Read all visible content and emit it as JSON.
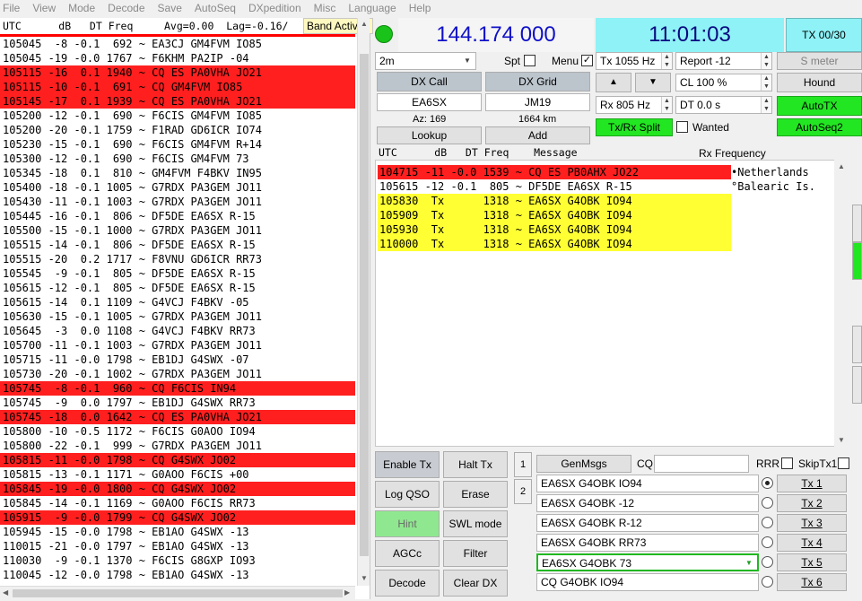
{
  "menu": [
    "File",
    "View",
    "Mode",
    "Decode",
    "Save",
    "AutoSeq",
    "DXpedition",
    "Misc",
    "Language",
    "Help"
  ],
  "band": {
    "header": "UTC      dB   DT Freq     Avg=0.00  Lag=-0.16/",
    "title": "Band Activity",
    "rows": [
      {
        "text": "105045  -8 -0.1  692 ~ EA3CJ GM4FVM IO85",
        "cq": false
      },
      {
        "text": "105045 -19 -0.0 1767 ~ F6KHM PA2IP -04",
        "cq": false
      },
      {
        "text": "105115 -16  0.1 1940 ~ CQ ES PA0VHA JO21",
        "cq": true
      },
      {
        "text": "105115 -10 -0.1  691 ~ CQ GM4FVM IO85",
        "cq": true
      },
      {
        "text": "105145 -17  0.1 1939 ~ CQ ES PA0VHA JO21",
        "cq": true
      },
      {
        "text": "105200 -12 -0.1  690 ~ F6CIS GM4FVM IO85",
        "cq": false
      },
      {
        "text": "105200 -20 -0.1 1759 ~ F1RAD GD6ICR IO74",
        "cq": false
      },
      {
        "text": "105230 -15 -0.1  690 ~ F6CIS GM4FVM R+14",
        "cq": false
      },
      {
        "text": "105300 -12 -0.1  690 ~ F6CIS GM4FVM 73",
        "cq": false
      },
      {
        "text": "105345 -18  0.1  810 ~ GM4FVM F4BKV IN95",
        "cq": false
      },
      {
        "text": "105400 -18 -0.1 1005 ~ G7RDX PA3GEM JO11",
        "cq": false
      },
      {
        "text": "105430 -11 -0.1 1003 ~ G7RDX PA3GEM JO11",
        "cq": false
      },
      {
        "text": "105445 -16 -0.1  806 ~ DF5DE EA6SX R-15",
        "cq": false
      },
      {
        "text": "105500 -15 -0.1 1000 ~ G7RDX PA3GEM JO11",
        "cq": false
      },
      {
        "text": "105515 -14 -0.1  806 ~ DF5DE EA6SX R-15",
        "cq": false
      },
      {
        "text": "105515 -20  0.2 1717 ~ F8VNU GD6ICR RR73",
        "cq": false
      },
      {
        "text": "105545  -9 -0.1  805 ~ DF5DE EA6SX R-15",
        "cq": false
      },
      {
        "text": "105615 -12 -0.1  805 ~ DF5DE EA6SX R-15",
        "cq": false
      },
      {
        "text": "105615 -14  0.1 1109 ~ G4VCJ F4BKV -05",
        "cq": false
      },
      {
        "text": "105630 -15 -0.1 1005 ~ G7RDX PA3GEM JO11",
        "cq": false
      },
      {
        "text": "105645  -3  0.0 1108 ~ G4VCJ F4BKV RR73",
        "cq": false
      },
      {
        "text": "105700 -11 -0.1 1003 ~ G7RDX PA3GEM JO11",
        "cq": false
      },
      {
        "text": "105715 -11 -0.0 1798 ~ EB1DJ G4SWX -07",
        "cq": false
      },
      {
        "text": "105730 -20 -0.1 1002 ~ G7RDX PA3GEM JO11",
        "cq": false
      },
      {
        "text": "105745  -8 -0.1  960 ~ CQ F6CIS IN94",
        "cq": true
      },
      {
        "text": "105745  -9  0.0 1797 ~ EB1DJ G4SWX RR73",
        "cq": false
      },
      {
        "text": "105745 -18  0.0 1642 ~ CQ ES PA0VHA JO21",
        "cq": true
      },
      {
        "text": "105800 -10 -0.5 1172 ~ F6CIS G0AOO IO94",
        "cq": false
      },
      {
        "text": "105800 -22 -0.1  999 ~ G7RDX PA3GEM JO11",
        "cq": false
      },
      {
        "text": "105815 -11 -0.0 1798 ~ CQ G4SWX JO02",
        "cq": true
      },
      {
        "text": "105815 -13 -0.1 1171 ~ G0AOO F6CIS +00",
        "cq": false
      },
      {
        "text": "105845 -19 -0.0 1800 ~ CQ G4SWX JO02",
        "cq": true
      },
      {
        "text": "105845 -14 -0.1 1169 ~ G0AOO F6CIS RR73",
        "cq": false
      },
      {
        "text": "105915  -9 -0.0 1799 ~ CQ G4SWX JO02",
        "cq": true
      },
      {
        "text": "105945 -15 -0.0 1798 ~ EB1AO G4SWX -13",
        "cq": false
      },
      {
        "text": "110015 -21 -0.0 1797 ~ EB1AO G4SWX -13",
        "cq": false
      },
      {
        "text": "110030  -9 -0.1 1370 ~ F6CIS G8GXP IO93",
        "cq": false
      },
      {
        "text": "110045 -12 -0.0 1798 ~ EB1AO G4SWX -13",
        "cq": false
      }
    ]
  },
  "top": {
    "frequency": "144.174 000",
    "clock": "11:01:03",
    "tx_counter": "TX 00/30",
    "band": "2m",
    "spt_label": "Spt",
    "menu_label": "Menu",
    "menu_check": "✓",
    "tx_freq": "Tx  1055 Hz",
    "rx_freq": "Rx  805 Hz",
    "report": "Report -12",
    "cl": "CL  100 %",
    "dt": "DT 0.0 s",
    "s_meter": "S meter",
    "hound": "Hound",
    "autotx": "AutoTX",
    "autoseq2": "AutoSeq2",
    "txrx_split": "Tx/Rx Split",
    "wanted": "Wanted",
    "up_arrow": "▲",
    "down_arrow": "▼",
    "dx_call_btn": "DX Call",
    "dx_grid_btn": "DX Grid",
    "dx_call": "EA6SX",
    "dx_grid": "JM19",
    "az": "Az: 169",
    "distance": "1664 km",
    "lookup": "Lookup",
    "add": "Add"
  },
  "rx": {
    "header": "UTC      dB   DT Freq    Message",
    "title": "Rx Frequency",
    "rows": [
      {
        "text": "104715 -11 -0.0 1539 ~ CQ ES PB0AHX JO22",
        "kind": "cq"
      },
      {
        "text": "105615 -12 -0.1  805 ~ DF5DE EA6SX R-15",
        "kind": "plain"
      },
      {
        "text": "105830  Tx      1318 ~ EA6SX G4OBK IO94",
        "kind": "tx"
      },
      {
        "text": "105909  Tx      1318 ~ EA6SX G4OBK IO94",
        "kind": "tx"
      },
      {
        "text": "105930  Tx      1318 ~ EA6SX G4OBK IO94",
        "kind": "tx"
      },
      {
        "text": "110000  Tx      1318 ~ EA6SX G4OBK IO94",
        "kind": "tx"
      }
    ],
    "countries": [
      "•Netherlands",
      "°Balearic Is."
    ]
  },
  "bottom": {
    "enable_tx": "Enable Tx",
    "halt_tx": "Halt Tx",
    "log_qso": "Log QSO",
    "erase": "Erase",
    "hint": "Hint",
    "swl_mode": "SWL mode",
    "agcc": "AGCc",
    "filter": "Filter",
    "decode": "Decode",
    "clear_dx": "Clear DX",
    "tab1": "1",
    "tab2": "2",
    "genmsgs": "GenMsgs",
    "cq_label": "CQ",
    "rrr": "RRR",
    "skiptx1": "SkipTx1",
    "messages": [
      {
        "text": "EA6SX G4OBK IO94",
        "btn": "Tx 1"
      },
      {
        "text": "EA6SX G4OBK -12",
        "btn": "Tx 2"
      },
      {
        "text": "EA6SX G4OBK R-12",
        "btn": "Tx 3"
      },
      {
        "text": "EA6SX G4OBK RR73",
        "btn": "Tx 4"
      },
      {
        "text": "EA6SX G4OBK 73",
        "btn": "Tx 5"
      },
      {
        "text": "CQ G4OBK IO94",
        "btn": "Tx 6"
      }
    ]
  }
}
